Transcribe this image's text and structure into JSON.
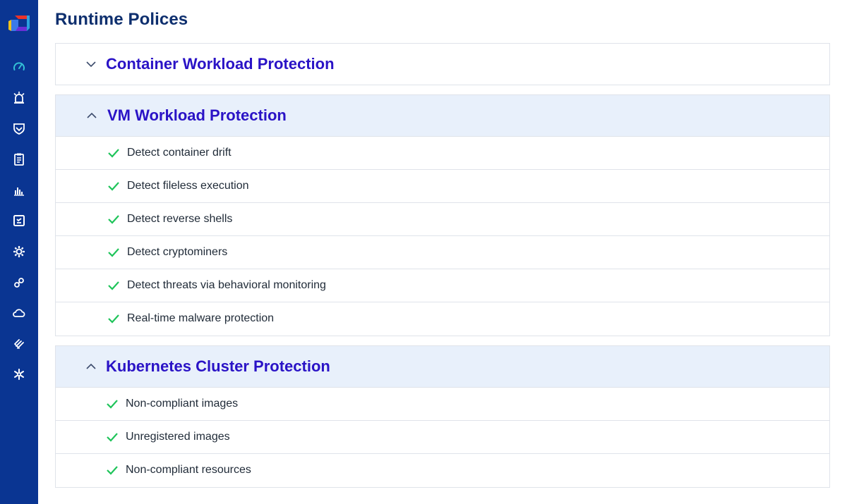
{
  "page": {
    "title": "Runtime Polices"
  },
  "sidebar": {
    "logo": "app-logo",
    "items": [
      {
        "icon": "dashboard-gauge-icon"
      },
      {
        "icon": "alarm-icon"
      },
      {
        "icon": "shield-icon"
      },
      {
        "icon": "clipboard-icon"
      },
      {
        "icon": "bar-chart-icon"
      },
      {
        "icon": "scan-frame-icon"
      },
      {
        "icon": "settings-cog-icon"
      },
      {
        "icon": "link-icon"
      },
      {
        "icon": "cloud-icon"
      },
      {
        "icon": "layers-icon"
      },
      {
        "icon": "sparkle-icon"
      }
    ]
  },
  "sections": [
    {
      "title": "Container Workload Protection",
      "expanded": false,
      "items": []
    },
    {
      "title": "VM Workload Protection",
      "expanded": true,
      "items": [
        "Detect container drift",
        "Detect fileless execution",
        "Detect reverse shells",
        "Detect cryptominers",
        "Detect threats via behavioral monitoring",
        "Real-time malware protection"
      ]
    },
    {
      "title": "Kubernetes Cluster Protection",
      "expanded": true,
      "items": [
        "Non-compliant images",
        "Unregistered images",
        "Non-compliant resources"
      ]
    }
  ],
  "colors": {
    "sidebar": "#0a3592",
    "page_title": "#0e2f6e",
    "section_title": "#2a13c6",
    "header_bg": "#e8f0fb",
    "check": "#1fc45a",
    "border": "#dfe3ea"
  }
}
